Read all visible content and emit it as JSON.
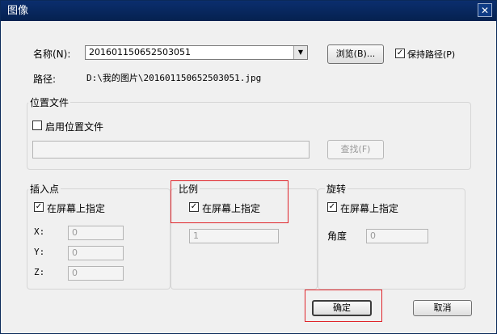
{
  "window": {
    "title": "图像",
    "close_glyph": "✕"
  },
  "name_row": {
    "label": "名称(N):",
    "value": "201601150652503051",
    "browse_button": "浏览(B)...",
    "keep_path_label": "保持路径(P)",
    "keep_path_checked": true
  },
  "path_row": {
    "label": "路径:",
    "value": "D:\\我的图片\\201601150652503051.jpg"
  },
  "location_file": {
    "group_title": "位置文件",
    "enable_label": "启用位置文件",
    "enable_checked": false,
    "path_value": "",
    "find_button": "查找(F)"
  },
  "insert_point": {
    "group_title": "插入点",
    "on_screen_label": "在屏幕上指定",
    "on_screen_checked": true,
    "x_label": "X:",
    "x_value": "0",
    "y_label": "Y:",
    "y_value": "0",
    "z_label": "Z:",
    "z_value": "0"
  },
  "scale": {
    "group_title": "比例",
    "on_screen_label": "在屏幕上指定",
    "on_screen_checked": true,
    "value": "1"
  },
  "rotation": {
    "group_title": "旋转",
    "on_screen_label": "在屏幕上指定",
    "on_screen_checked": true,
    "angle_label": "角度",
    "angle_value": "0"
  },
  "buttons": {
    "ok": "确定",
    "cancel": "取消"
  },
  "check_glyph": "✓",
  "colors": {
    "titlebar": "#0b2e6e",
    "highlight_box": "#e0242a",
    "dialog_bg": "#f0f0f0"
  }
}
